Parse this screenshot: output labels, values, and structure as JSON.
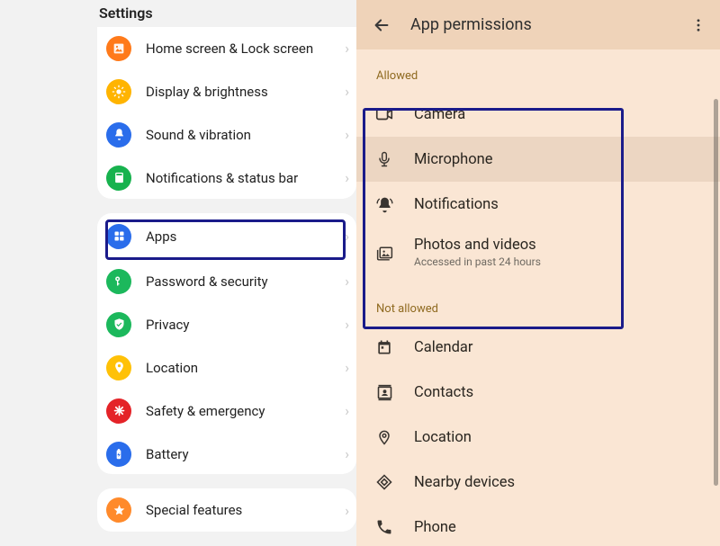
{
  "left": {
    "header": "Settings",
    "groups": [
      {
        "id": "g1",
        "items": [
          {
            "id": "home",
            "label": "Home screen & Lock screen",
            "icon": "home-icon",
            "color": "orange"
          },
          {
            "id": "display",
            "label": "Display & brightness",
            "icon": "brightness-icon",
            "color": "yellow"
          },
          {
            "id": "sound",
            "label": "Sound & vibration",
            "icon": "bell-icon",
            "color": "blue"
          },
          {
            "id": "notif",
            "label": "Notifications & status bar",
            "icon": "notification-panel-icon",
            "color": "green"
          }
        ]
      },
      {
        "id": "g2",
        "items": [
          {
            "id": "apps",
            "label": "Apps",
            "icon": "apps-grid-icon",
            "color": "blue",
            "highlight": true
          },
          {
            "id": "pass",
            "label": "Password & security",
            "icon": "key-icon",
            "color": "greenL"
          },
          {
            "id": "priv",
            "label": "Privacy",
            "icon": "shield-icon",
            "color": "greenL"
          },
          {
            "id": "loc",
            "label": "Location",
            "icon": "pin-icon",
            "color": "yellow2"
          },
          {
            "id": "safety",
            "label": "Safety & emergency",
            "icon": "asterisk-icon",
            "color": "red"
          },
          {
            "id": "batt",
            "label": "Battery",
            "icon": "battery-icon",
            "color": "blue"
          }
        ]
      },
      {
        "id": "g3",
        "items": [
          {
            "id": "special",
            "label": "Special features",
            "icon": "star-icon",
            "color": "orange2"
          }
        ]
      }
    ]
  },
  "right": {
    "title": "App permissions",
    "allowed_header": "Allowed",
    "notallowed_header": "Not allowed",
    "allowed": [
      {
        "id": "cam",
        "label": "Camera",
        "icon": "camera-icon"
      },
      {
        "id": "mic",
        "label": "Microphone",
        "icon": "microphone-icon",
        "highlight_row": true
      },
      {
        "id": "pnotif",
        "label": "Notifications",
        "icon": "bell-solid-icon"
      },
      {
        "id": "photos",
        "label": "Photos and videos",
        "sub": "Accessed in past 24 hours",
        "icon": "gallery-icon"
      }
    ],
    "notallowed": [
      {
        "id": "cal",
        "label": "Calendar",
        "icon": "calendar-icon"
      },
      {
        "id": "cont",
        "label": "Contacts",
        "icon": "contacts-icon"
      },
      {
        "id": "ploc",
        "label": "Location",
        "icon": "pin-outline-icon"
      },
      {
        "id": "near",
        "label": "Nearby devices",
        "icon": "diamond-icon"
      },
      {
        "id": "phone",
        "label": "Phone",
        "icon": "phone-icon"
      }
    ]
  },
  "colors": {
    "highlight_border": "#1A1B8A",
    "right_bg": "#FAE6D4",
    "right_header_bg": "#EFD3B9"
  }
}
